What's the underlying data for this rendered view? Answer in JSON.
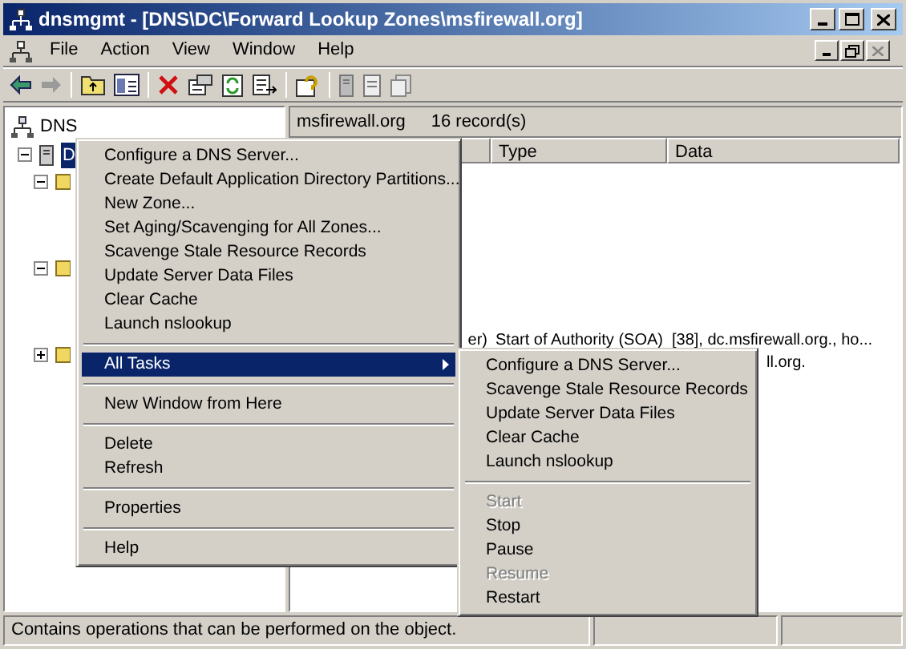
{
  "window": {
    "title": "dnsmgmt - [DNS\\DC\\Forward Lookup Zones\\msfirewall.org]"
  },
  "menu_bar": [
    "File",
    "Action",
    "View",
    "Window",
    "Help"
  ],
  "tree": {
    "label": "DNS",
    "children": [
      {
        "label": "D",
        "selected": true
      }
    ]
  },
  "details": {
    "zone": "msfirewall.org",
    "count": "16 record(s)",
    "columns": [
      "",
      "Type",
      "Data"
    ],
    "rows": [
      [
        "er)",
        "Start of Authority (SOA)",
        "[38], dc.msfirewall.org., ho..."
      ],
      [
        "",
        "",
        "ll.org."
      ]
    ]
  },
  "context_menu": [
    {
      "kind": "item",
      "label": "Configure a DNS Server...",
      "selected": false
    },
    {
      "kind": "item",
      "label": "Create Default Application Directory Partitions...",
      "selected": false
    },
    {
      "kind": "item",
      "label": "New Zone...",
      "selected": false
    },
    {
      "kind": "item",
      "label": "Set Aging/Scavenging for All Zones...",
      "selected": false
    },
    {
      "kind": "item",
      "label": "Scavenge Stale Resource Records",
      "selected": false
    },
    {
      "kind": "item",
      "label": "Update Server Data Files",
      "selected": false
    },
    {
      "kind": "item",
      "label": "Clear Cache",
      "selected": false
    },
    {
      "kind": "item",
      "label": "Launch nslookup",
      "selected": false
    },
    {
      "kind": "separator"
    },
    {
      "kind": "submenu",
      "label": "All Tasks",
      "selected": true
    },
    {
      "kind": "separator"
    },
    {
      "kind": "item",
      "label": "New Window from Here",
      "selected": false
    },
    {
      "kind": "separator"
    },
    {
      "kind": "item",
      "label": "Delete",
      "selected": false
    },
    {
      "kind": "item",
      "label": "Refresh",
      "selected": false
    },
    {
      "kind": "separator"
    },
    {
      "kind": "item",
      "label": "Properties",
      "selected": false
    },
    {
      "kind": "separator"
    },
    {
      "kind": "item",
      "label": "Help",
      "selected": false
    }
  ],
  "submenu": [
    {
      "kind": "item",
      "label": "Configure a DNS Server...",
      "disabled": false
    },
    {
      "kind": "item",
      "label": "Scavenge Stale Resource Records",
      "disabled": false
    },
    {
      "kind": "item",
      "label": "Update Server Data Files",
      "disabled": false
    },
    {
      "kind": "item",
      "label": "Clear Cache",
      "disabled": false
    },
    {
      "kind": "item",
      "label": "Launch nslookup",
      "disabled": false
    },
    {
      "kind": "separator"
    },
    {
      "kind": "item",
      "label": "Start",
      "disabled": true
    },
    {
      "kind": "item",
      "label": "Stop",
      "disabled": false
    },
    {
      "kind": "item",
      "label": "Pause",
      "disabled": false
    },
    {
      "kind": "item",
      "label": "Resume",
      "disabled": true
    },
    {
      "kind": "item",
      "label": "Restart",
      "disabled": false
    }
  ],
  "status_bar": "Contains operations that can be performed on the object."
}
